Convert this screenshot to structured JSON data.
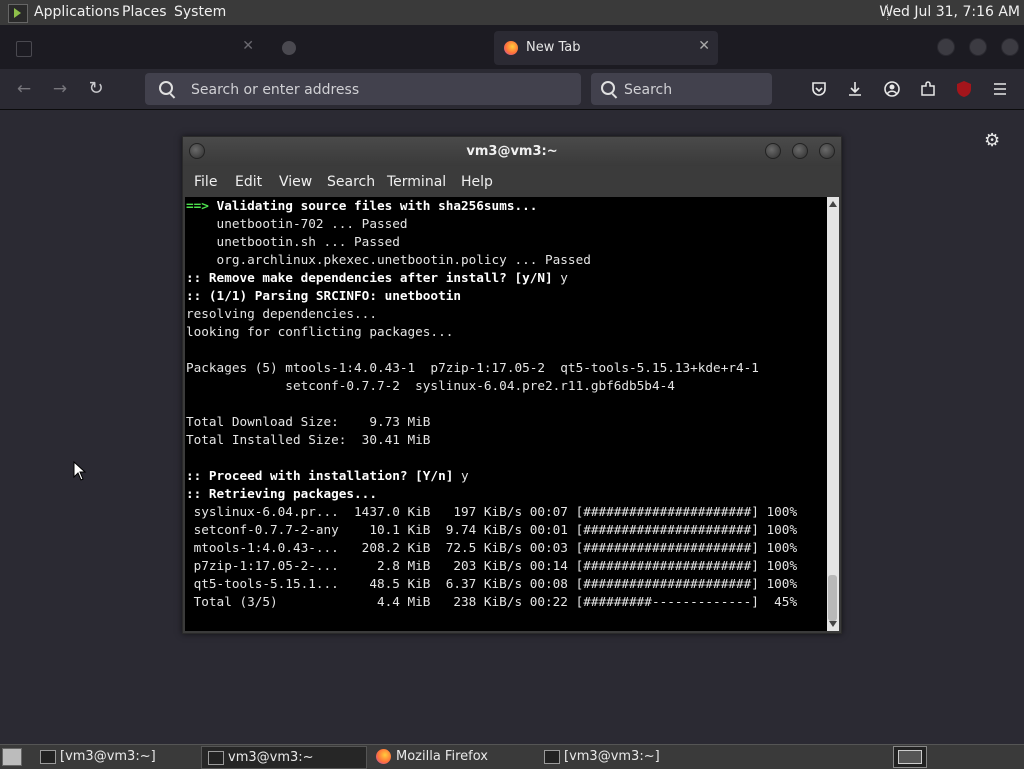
{
  "top_panel": {
    "menus": [
      "Applications",
      "Places",
      "System"
    ],
    "clock": "Wed Jul 31, 7:16 AM"
  },
  "browser": {
    "tabs": [
      {
        "label": "",
        "icon": "tab-favicon"
      },
      {
        "label": "",
        "icon": "tab-favicon"
      },
      {
        "label": "New Tab",
        "icon": "firefox-icon",
        "active": true
      }
    ],
    "url_placeholder": "Search or enter address",
    "search_placeholder": "Search",
    "toolbar_icons": [
      "pocket-icon",
      "download-icon",
      "account-icon",
      "extensions-icon",
      "ublock-icon",
      "hamburger-menu-icon"
    ],
    "ublock_badge": "",
    "accent_color": "#2b2a33"
  },
  "terminal": {
    "title": "vm3@vm3:~",
    "menu": [
      "File",
      "Edit",
      "View",
      "Search",
      "Terminal",
      "Help"
    ],
    "lines": [
      [
        {
          "t": "==> ",
          "s": "g"
        },
        {
          "t": "Validating source files with sha256sums...",
          "s": "b"
        }
      ],
      [
        {
          "t": "    unetbootin-702 ... Passed"
        }
      ],
      [
        {
          "t": "    unetbootin.sh ... Passed"
        }
      ],
      [
        {
          "t": "    org.archlinux.pkexec.unetbootin.policy ... Passed"
        }
      ],
      [
        {
          "t": ":: Remove make dependencies after install? [y/N] ",
          "s": "b"
        },
        {
          "t": "y"
        }
      ],
      [
        {
          "t": ":: (1/1) Parsing SRCINFO: unetbootin",
          "s": "b"
        }
      ],
      [
        {
          "t": "resolving dependencies..."
        }
      ],
      [
        {
          "t": "looking for conflicting packages..."
        }
      ],
      [
        {
          "t": ""
        }
      ],
      [
        {
          "t": "Packages (5) mtools-1:4.0.43-1  p7zip-1:17.05-2  qt5-tools-5.15.13+kde+r4-1"
        }
      ],
      [
        {
          "t": "             setconf-0.7.7-2  syslinux-6.04.pre2.r11.gbf6db5b4-4"
        }
      ],
      [
        {
          "t": ""
        }
      ],
      [
        {
          "t": "Total Download Size:    9.73 MiB"
        }
      ],
      [
        {
          "t": "Total Installed Size:  30.41 MiB"
        }
      ],
      [
        {
          "t": ""
        }
      ],
      [
        {
          "t": ":: Proceed with installation? [Y/n] ",
          "s": "b"
        },
        {
          "t": "y"
        }
      ],
      [
        {
          "t": ":: Retrieving packages...",
          "s": "b"
        }
      ],
      [
        {
          "t": " syslinux-6.04.pr...  1437.0 KiB   197 KiB/s 00:07 [######################] 100%"
        }
      ],
      [
        {
          "t": " setconf-0.7.7-2-any    10.1 KiB  9.74 KiB/s 00:01 [######################] 100%"
        }
      ],
      [
        {
          "t": " mtools-1:4.0.43-...   208.2 KiB  72.5 KiB/s 00:03 [######################] 100%"
        }
      ],
      [
        {
          "t": " p7zip-1:17.05-2-...     2.8 MiB   203 KiB/s 00:14 [######################] 100%"
        }
      ],
      [
        {
          "t": " qt5-tools-5.15.1...    48.5 KiB  6.37 KiB/s 00:08 [######################] 100%"
        }
      ],
      [
        {
          "t": " Total (3/5)             4.4 MiB   238 KiB/s 00:22 [#########-------------]  45%"
        }
      ]
    ]
  },
  "bottom_panel": {
    "tasks": [
      {
        "label": "[vm3@vm3:~]",
        "icon": "terminal-icon",
        "active": false
      },
      {
        "label": "vm3@vm3:~",
        "icon": "terminal-icon",
        "active": true
      },
      {
        "label": "Mozilla Firefox",
        "icon": "firefox-icon",
        "active": false
      },
      {
        "label": "[vm3@vm3:~]",
        "icon": "terminal-icon",
        "active": false
      }
    ]
  }
}
